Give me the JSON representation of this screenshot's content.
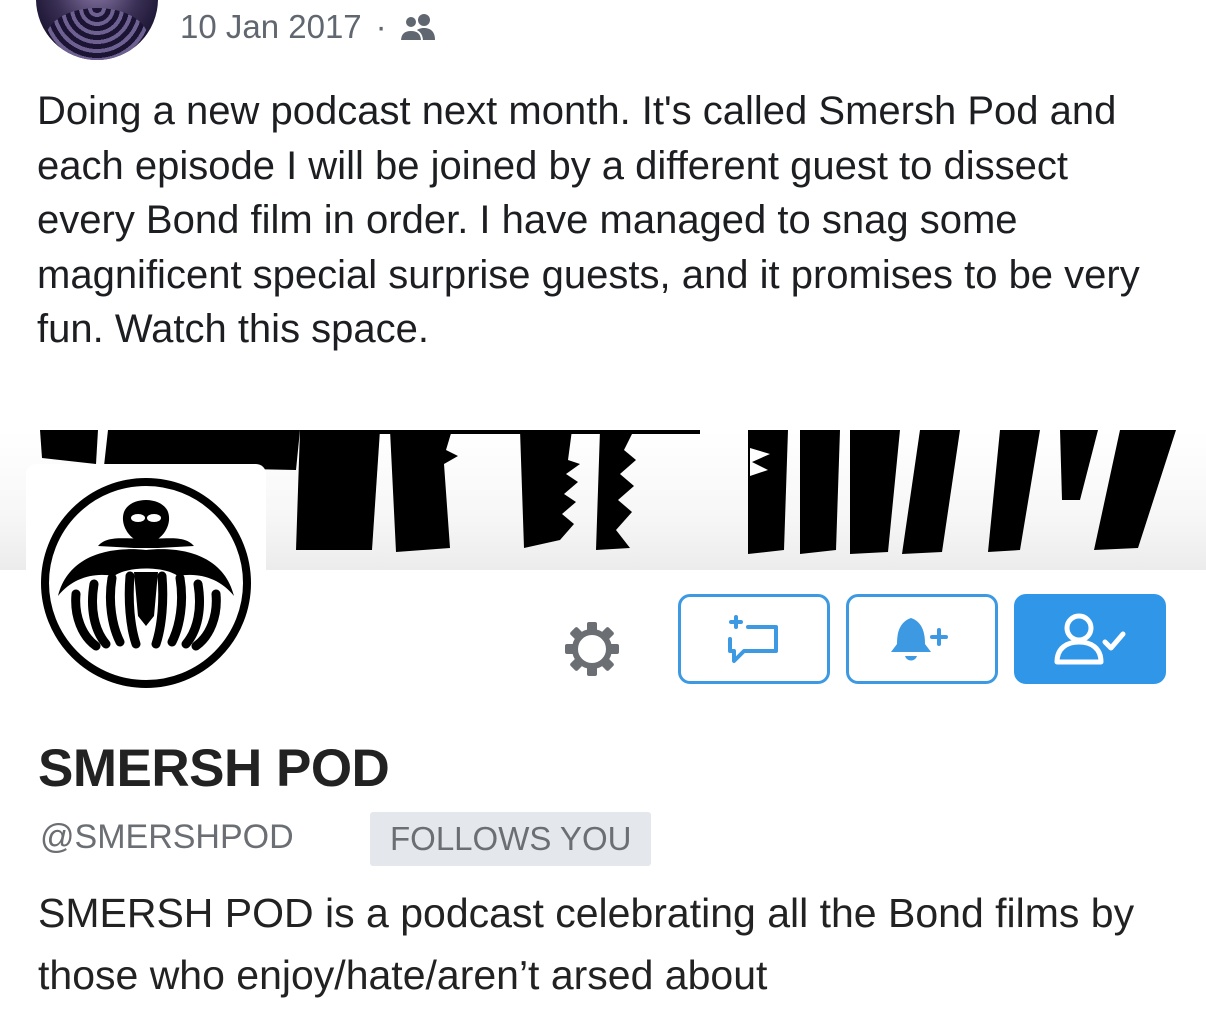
{
  "post": {
    "date": "10 Jan 2017",
    "separator": "·",
    "audience_icon": "friends-icon",
    "text": "Doing a new podcast next month. It's called Smersh Pod and each episode I will be joined by a different guest to dissect every Bond film in order. I have managed to snag some magnificent special surprise guests, and it promises to be very fun. Watch this space."
  },
  "profile_card": {
    "display_name": "SMERSH POD",
    "handle": "@SMERSHPOD",
    "follows_badge": "FOLLOWS YOU",
    "bio": "SMERSH POD is a podcast celebrating all the Bond films by those who enjoy/hate/aren’t arsed about",
    "icons": {
      "settings": "gear-icon",
      "message": "direct-message-icon",
      "notifications": "bell-plus-icon",
      "following": "following-user-check-icon"
    },
    "colors": {
      "accent": "#2f96e8",
      "accent_border": "#3d9ae2",
      "badge_bg": "#e4e8ec",
      "muted_text": "#6b6f73"
    }
  }
}
